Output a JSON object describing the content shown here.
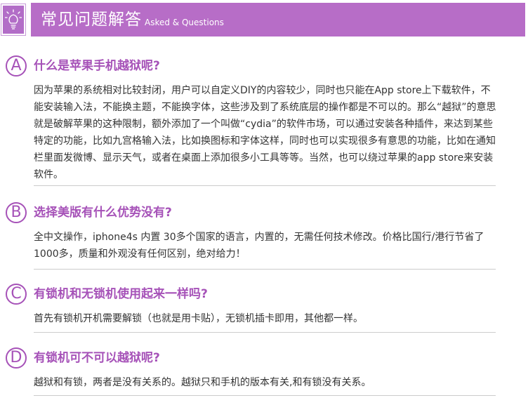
{
  "header": {
    "title": "常见问题解答",
    "subtitle": "Asked & Questions",
    "icon": "lightbulb-icon"
  },
  "colors": {
    "accent": "#a652b8",
    "bar": "#b76dc7",
    "text": "#333333",
    "separator": "#cccccc"
  },
  "faqs": [
    {
      "letter": "A",
      "question": "什么是苹果手机越狱呢?",
      "answer": "因为苹果的系统相对比较封闭，用户可以自定义DIY的内容较少，同时也只能在App store上下载软件，不能安装输入法，不能换主题，不能换字体，这些涉及到了系统底层的操作都是不可以的。那么“越狱”的意思就是破解苹果的这种限制，额外添加了一个叫做“cydia”的软件市场，可以通过安装各种插件，来达到某些特定的功能，比如九宫格输入法，比如换图标和字体这样，同时也可以实现很多有意思的功能，比如在通知栏里面发微博、显示天气，或者在桌面上添加很多小工具等等。当然，也可以绕过苹果的app store来安装软件。"
    },
    {
      "letter": "B",
      "question": "选择美版有什么优势没有?",
      "answer": "全中文操作，iphone4s 内置 30多个国家的语言，内置的，无需任何技术修改。价格比国行/港行节省了1000多，质量和外观没有任何区别，绝对给力！"
    },
    {
      "letter": "C",
      "question": "有锁机和无锁机使用起来一样吗?",
      "answer": "首先有锁机开机需要解锁（也就是用卡贴），无锁机插卡即用，其他都一样。"
    },
    {
      "letter": "D",
      "question": "有锁机可不可以越狱呢?",
      "answer": "越狱和有锁，两者是没有关系的。越狱只和手机的版本有关,和有锁没有关系。"
    }
  ]
}
